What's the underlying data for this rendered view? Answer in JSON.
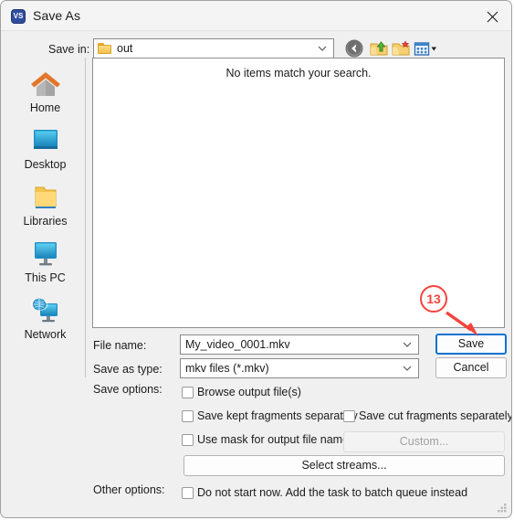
{
  "window": {
    "title": "Save As",
    "app_icon": "vs-icon",
    "app_icon_text": "VS",
    "close_icon": "close-icon"
  },
  "toolbar": {
    "save_in_label": "Save in:",
    "current_folder": "out",
    "buttons": [
      {
        "name": "back-button",
        "icon": "back-arrow-icon"
      },
      {
        "name": "up-one-level-button",
        "icon": "up-folder-icon"
      },
      {
        "name": "new-folder-button",
        "icon": "new-folder-icon"
      },
      {
        "name": "views-button",
        "icon": "views-grid-icon"
      }
    ]
  },
  "sidebar": {
    "items": [
      {
        "label": "Home",
        "icon": "home-icon"
      },
      {
        "label": "Desktop",
        "icon": "desktop-monitor-icon"
      },
      {
        "label": "Libraries",
        "icon": "libraries-folder-icon"
      },
      {
        "label": "This PC",
        "icon": "this-pc-monitor-icon"
      },
      {
        "label": "Network",
        "icon": "network-globe-icon"
      }
    ]
  },
  "file_list": {
    "empty_message": "No items match your search."
  },
  "form": {
    "file_name_label": "File name:",
    "file_name_value": "My_video_0001.mkv",
    "save_as_type_label": "Save as type:",
    "save_as_type_value": "mkv files (*.mkv)",
    "save_options_label": "Save options:",
    "other_options_label": "Other options:"
  },
  "buttons": {
    "save": "Save",
    "cancel": "Cancel",
    "custom": "Custom...",
    "select_streams": "Select streams..."
  },
  "checkboxes": [
    {
      "label": "Browse output file(s)",
      "checked": false
    },
    {
      "label": "Save kept fragments separately",
      "checked": false
    },
    {
      "label": "Save cut fragments separately",
      "checked": false
    },
    {
      "label": "Use mask for output file names",
      "checked": false
    },
    {
      "label": "Do not start now. Add the task to batch queue instead",
      "checked": false
    }
  ],
  "annotation": {
    "step_number": "13",
    "color": "#f4433c",
    "points_to": "save-button"
  },
  "colors": {
    "accent_focus": "#0a72d0",
    "dialog_bg": "#f0f0f0",
    "panel_bg": "#ffffff",
    "annotation_red": "#f4433c"
  }
}
